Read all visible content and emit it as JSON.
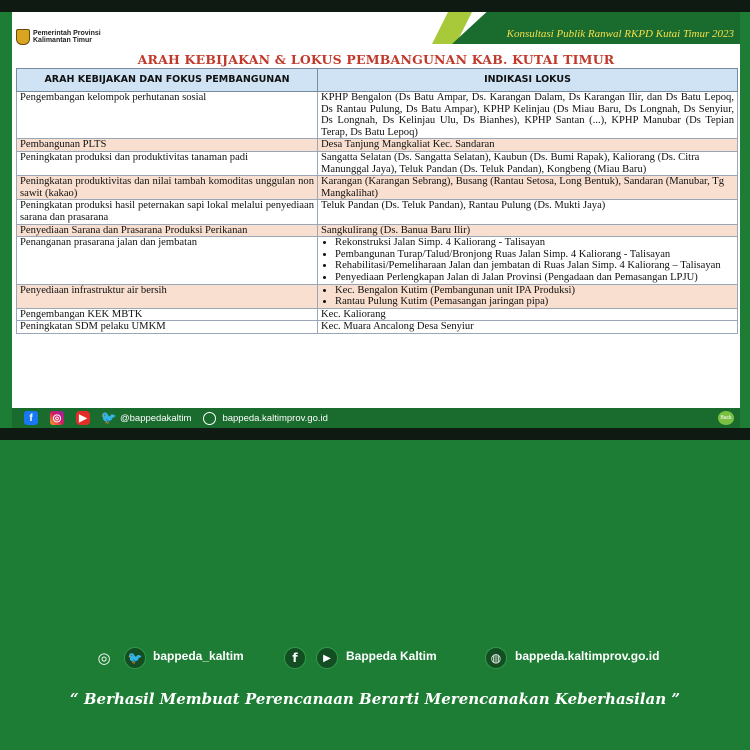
{
  "header": {
    "logo_line1": "Pemerintah Provinsi",
    "logo_line2": "Kalimantan Timur",
    "konsultasi": "Konsultasi  Publik Ranwal RKPD Kutai Timur  2023"
  },
  "title": "ARAH KEBIJAKAN & LOKUS PEMBANGUNAN KAB. KUTAI TIMUR",
  "table": {
    "col1_header": "ARAH KEBIJAKAN DAN FOKUS PEMBANGUNAN",
    "col2_header": "INDIKASI LOKUS",
    "rows": [
      {
        "kebijakan": "Pengembangan kelompok perhutanan sosial",
        "lokus": "KPHP Bengalon (Ds Batu Ampar, Ds. Karangan Dalam, Ds Karangan Ilir, dan Ds Batu Lepoq, Ds Rantau Pulung, Ds Batu Ampar), KPHP Kelinjau (Ds Miau Baru, Ds Longnah, Ds Senyiur, Ds Longnah, Ds Kelinjau Ulu, Ds Bianhes), KPHP Santan (...), KPHP Manubar (Ds Tepian Terap, Ds Batu Lepoq)"
      },
      {
        "kebijakan": "Pembangunan PLTS",
        "lokus": "Desa Tanjung Mangkaliat Kec. Sandaran"
      },
      {
        "kebijakan": "Peningkatan produksi dan produktivitas tanaman padi",
        "lokus": "Sangatta Selatan (Ds. Sangatta Selatan), Kaubun (Ds. Bumi Rapak), Kaliorang (Ds. Citra Manunggal Jaya), Teluk Pandan (Ds. Teluk Pandan), Kongbeng (Miau Baru)"
      },
      {
        "kebijakan": "Peningkatan produktivitas dan nilai tambah komoditas unggulan non sawit (kakao)",
        "lokus": "Karangan (Karangan Sebrang), Busang (Rantau Setosa, Long Bentuk), Sandaran (Manubar, Tg Mangkalihat)"
      },
      {
        "kebijakan": "Peningkatan produksi hasil peternakan sapi lokal melalui penyediaan sarana dan prasarana",
        "lokus": "Teluk Pandan (Ds. Teluk Pandan), Rantau Pulung (Ds. Mukti Jaya)"
      },
      {
        "kebijakan": "Penyediaan Sarana dan Prasarana Produksi Perikanan",
        "lokus": "Sangkulirang (Ds. Banua Baru Ilir)"
      },
      {
        "kebijakan": "Penanganan prasarana jalan dan jembatan",
        "lokus_list": [
          "Rekonstruksi Jalan Simp. 4 Kaliorang - Talisayan",
          "Pembangunan Turap/Talud/Bronjong Ruas Jalan Simp. 4 Kaliorang - Talisayan",
          "Rehabilitasi/Pemeliharaan Jalan dan jembatan di Ruas Jalan Simp. 4 Kaliorang – Talisayan",
          "Penyediaan Perlengkapan Jalan di Jalan Provinsi (Pengadaan dan Pemasangan LPJU)"
        ]
      },
      {
        "kebijakan": "Penyediaan infrastruktur air bersih",
        "lokus_list": [
          "Kec. Bengalon Kutim (Pembangunan unit IPA Produksi)",
          "Rantau Pulung Kutim (Pemasangan jaringan pipa)"
        ]
      },
      {
        "kebijakan": "Pengembangan KEK MBTK",
        "lokus": "Kec. Kaliorang"
      },
      {
        "kebijakan": "Peningkatan SDM pelaku UMKM",
        "lokus": "Kec. Muara Ancalong Desa Senyiur"
      }
    ]
  },
  "slide_footer": {
    "handle": "@bappedakaltim",
    "website": "bappeda.kaltimprov.go.id",
    "back_label": "Back"
  },
  "bottom": {
    "handle": "bappeda_kaltim",
    "name": "Bappeda Kaltim",
    "website": "bappeda.kaltimprov.go.id",
    "tagline": "“ Berhasil  Membuat Perencanaan Berarti Merencanakan Keberhasilan ”"
  },
  "colors": {
    "green": "#1e7d34",
    "title_red": "#c0392b",
    "header_blue": "#cfe3f4",
    "row_peach": "#f8dfcf",
    "konsultasi_yellow": "#f5e04a"
  },
  "icons": [
    "instagram-icon",
    "twitter-icon",
    "facebook-icon",
    "youtube-icon",
    "globe-icon",
    "back-icon"
  ]
}
